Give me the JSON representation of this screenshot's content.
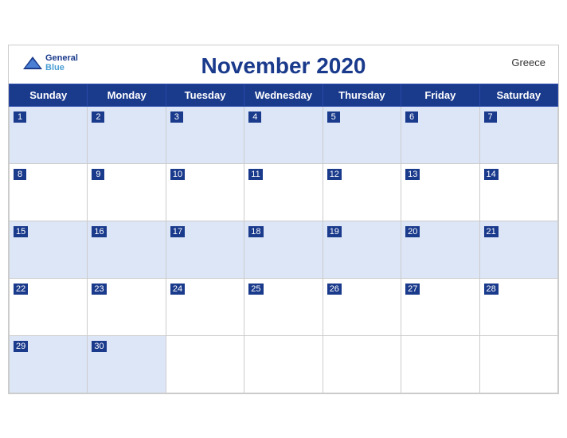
{
  "header": {
    "title": "November 2020",
    "country": "Greece",
    "brand_line1": "General",
    "brand_line2": "Blue"
  },
  "days_of_week": [
    "Sunday",
    "Monday",
    "Tuesday",
    "Wednesday",
    "Thursday",
    "Friday",
    "Saturday"
  ],
  "weeks": [
    [
      {
        "day": 1,
        "empty": false
      },
      {
        "day": 2,
        "empty": false
      },
      {
        "day": 3,
        "empty": false
      },
      {
        "day": 4,
        "empty": false
      },
      {
        "day": 5,
        "empty": false
      },
      {
        "day": 6,
        "empty": false
      },
      {
        "day": 7,
        "empty": false
      }
    ],
    [
      {
        "day": 8,
        "empty": false
      },
      {
        "day": 9,
        "empty": false
      },
      {
        "day": 10,
        "empty": false
      },
      {
        "day": 11,
        "empty": false
      },
      {
        "day": 12,
        "empty": false
      },
      {
        "day": 13,
        "empty": false
      },
      {
        "day": 14,
        "empty": false
      }
    ],
    [
      {
        "day": 15,
        "empty": false
      },
      {
        "day": 16,
        "empty": false
      },
      {
        "day": 17,
        "empty": false
      },
      {
        "day": 18,
        "empty": false
      },
      {
        "day": 19,
        "empty": false
      },
      {
        "day": 20,
        "empty": false
      },
      {
        "day": 21,
        "empty": false
      }
    ],
    [
      {
        "day": 22,
        "empty": false
      },
      {
        "day": 23,
        "empty": false
      },
      {
        "day": 24,
        "empty": false
      },
      {
        "day": 25,
        "empty": false
      },
      {
        "day": 26,
        "empty": false
      },
      {
        "day": 27,
        "empty": false
      },
      {
        "day": 28,
        "empty": false
      }
    ],
    [
      {
        "day": 29,
        "empty": false
      },
      {
        "day": 30,
        "empty": false
      },
      {
        "day": null,
        "empty": true
      },
      {
        "day": null,
        "empty": true
      },
      {
        "day": null,
        "empty": true
      },
      {
        "day": null,
        "empty": true
      },
      {
        "day": null,
        "empty": true
      }
    ]
  ]
}
